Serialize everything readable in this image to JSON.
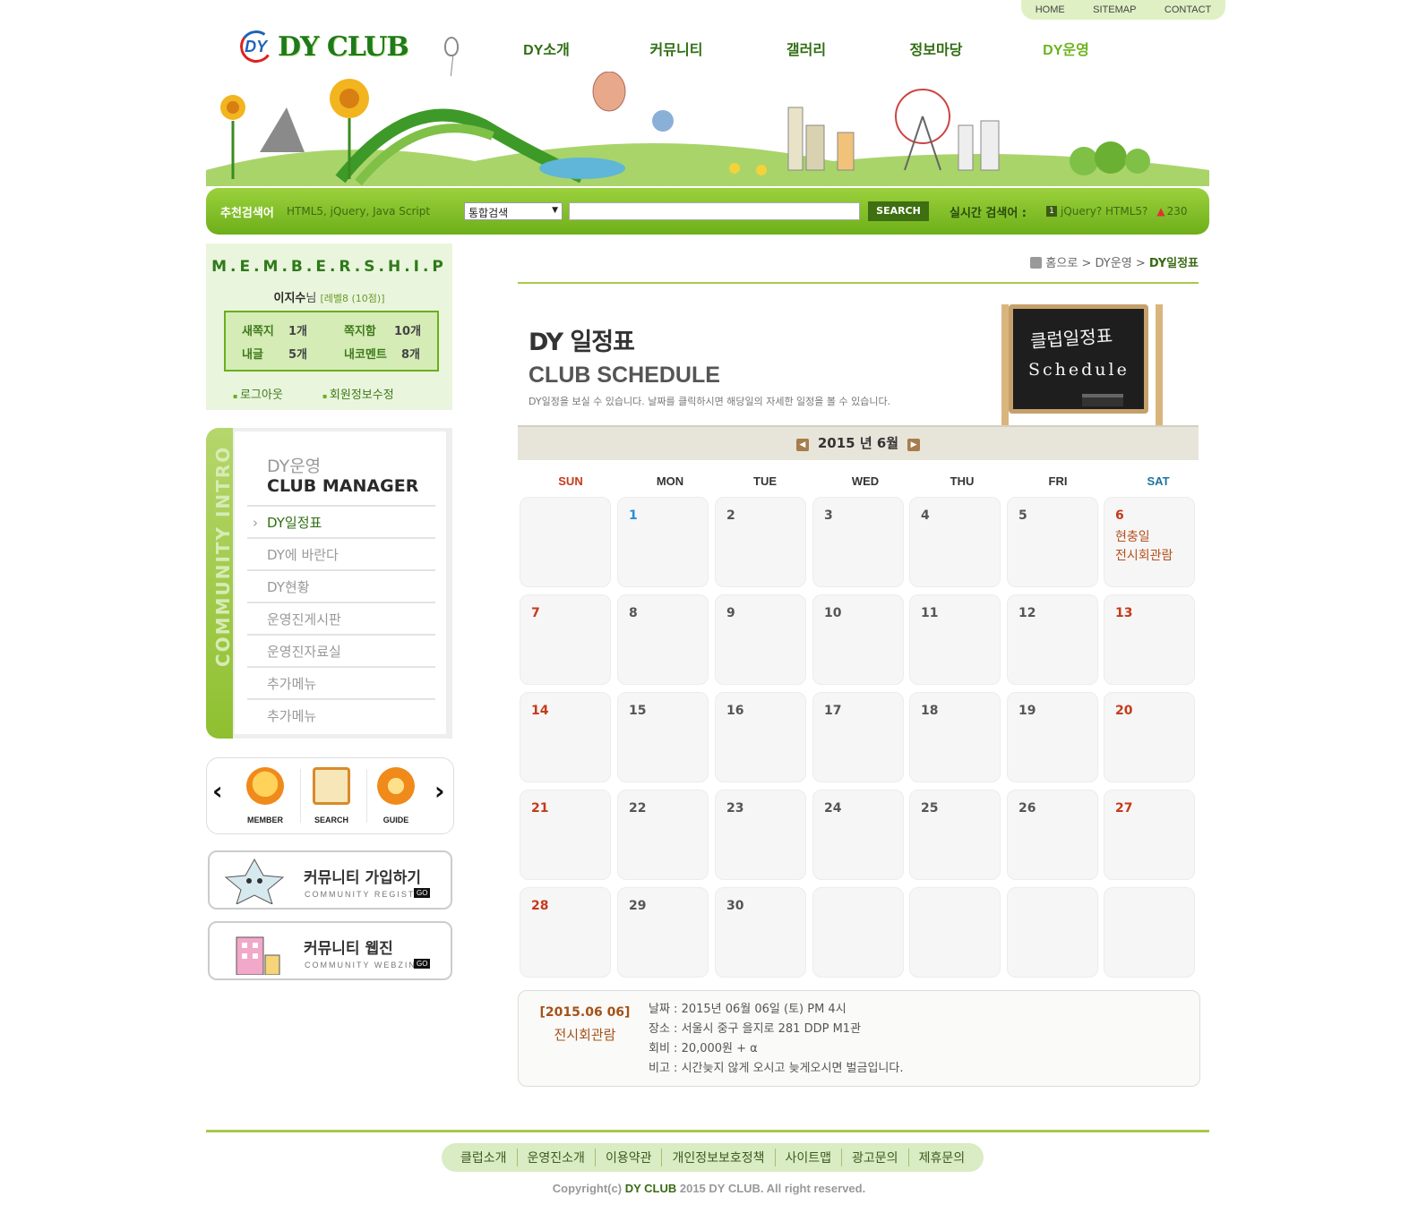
{
  "util_menu": [
    "HOME",
    "SITEMAP",
    "CONTACT"
  ],
  "logo": {
    "mark": "DY",
    "name": "DY CLUB"
  },
  "gnb": [
    {
      "label": "DY소개",
      "active": false
    },
    {
      "label": "커뮤니티",
      "active": false
    },
    {
      "label": "갤러리",
      "active": false
    },
    {
      "label": "정보마당",
      "active": false
    },
    {
      "label": "DY운영",
      "active": true
    }
  ],
  "search": {
    "recommend_label": "추천검색어",
    "recommend_keywords": "HTML5, jQuery, Java Script",
    "select_value": "통합검색",
    "input_value": "",
    "button_label": "SEARCH",
    "realtime_label": "실시간 검색어 :",
    "realtime_rank": "1",
    "realtime_keyword": "jQuery? HTML5?",
    "realtime_count": "230"
  },
  "membership": {
    "title": "M.E.M.B.E.R.S.H.I.P",
    "user_name": "이지수",
    "user_suffix": "님",
    "user_level": "[레벨8 (10점)]",
    "stats": [
      {
        "label": "새쪽지",
        "value": "1개"
      },
      {
        "label": "쪽지함",
        "value": "10개"
      },
      {
        "label": "내글",
        "value": "5개"
      },
      {
        "label": "내코멘트",
        "value": "8개"
      }
    ],
    "logout": "로그아웃",
    "edit_info": "회원정보수정"
  },
  "side_menu": {
    "vertical_text": "COMMUNITY INTRO",
    "title_ko": "DY운영",
    "title_en": "CLUB MANAGER",
    "items": [
      {
        "label": "DY일정표",
        "active": true
      },
      {
        "label": "DY에 바란다",
        "active": false
      },
      {
        "label": "DY현황",
        "active": false
      },
      {
        "label": "운영진게시판",
        "active": false
      },
      {
        "label": "운영진자료실",
        "active": false
      },
      {
        "label": "추가메뉴",
        "active": false
      },
      {
        "label": "추가메뉴",
        "active": false
      }
    ]
  },
  "quick_icons": [
    {
      "label": "MEMBER",
      "icon": "member-icon"
    },
    {
      "label": "SEARCH",
      "icon": "search-icon"
    },
    {
      "label": "GUIDE",
      "icon": "guide-icon"
    }
  ],
  "banners": [
    {
      "title": "커뮤니티 가입하기",
      "sub": "COMMUNITY REGISTE",
      "go": "GO"
    },
    {
      "title": "커뮤니티 웹진",
      "sub": "COMMUNITY WEBZINE",
      "go": "GO"
    }
  ],
  "breadcrumb": {
    "home": "홈으로",
    "sep": ">",
    "level1": "DY운영",
    "current": "DY일정표"
  },
  "page": {
    "title": "DY 일정표",
    "subtitle": "CLUB SCHEDULE",
    "description": "DY일정을 보실 수 있습니다. 날짜를 클릭하시면 해당일의 자세한 일정을 볼 수 있습니다.",
    "board_text_1": "클럽일정표",
    "board_text_2": "Schedule"
  },
  "calendar": {
    "month_label": "2015 년 6월",
    "weekdays": [
      "SUN",
      "MON",
      "TUE",
      "WED",
      "THU",
      "FRI",
      "SAT"
    ],
    "weeks": [
      [
        "",
        "1",
        "2",
        "3",
        "4",
        "5",
        "6"
      ],
      [
        "7",
        "8",
        "9",
        "10",
        "11",
        "12",
        "13"
      ],
      [
        "14",
        "15",
        "16",
        "17",
        "18",
        "19",
        "20"
      ],
      [
        "21",
        "22",
        "23",
        "24",
        "25",
        "26",
        "27"
      ],
      [
        "28",
        "29",
        "30",
        "",
        "",
        "",
        ""
      ]
    ],
    "today": "1",
    "events": {
      "6": [
        "현충일",
        "전시회관람"
      ]
    }
  },
  "event_detail": {
    "date": "[2015.06 06]",
    "title": "전시회관람",
    "rows": [
      "날짜 : 2015년 06월 06일 (토) PM 4시",
      "장소 : 서울시 중구 을지로 281 DDP M1관",
      "회비 : 20,000원 + α",
      "비고 : 시간늦지 않게 오시고 늦게오시면 벌금입니다."
    ]
  },
  "footer": {
    "links": [
      "클럽소개",
      "운영진소개",
      "이용약관",
      "개인정보보호정책",
      "사이트맵",
      "광고문의",
      "제휴문의"
    ],
    "copy_prefix": "Copyright(c)",
    "copy_brand": "DY CLUB",
    "copy_suffix": "2015 DY CLUB. All right reserved."
  },
  "colors": {
    "accent": "#6eaf1a",
    "dark_green": "#2f6e12",
    "sunday": "#c53a1a",
    "event": "#b5501a"
  }
}
